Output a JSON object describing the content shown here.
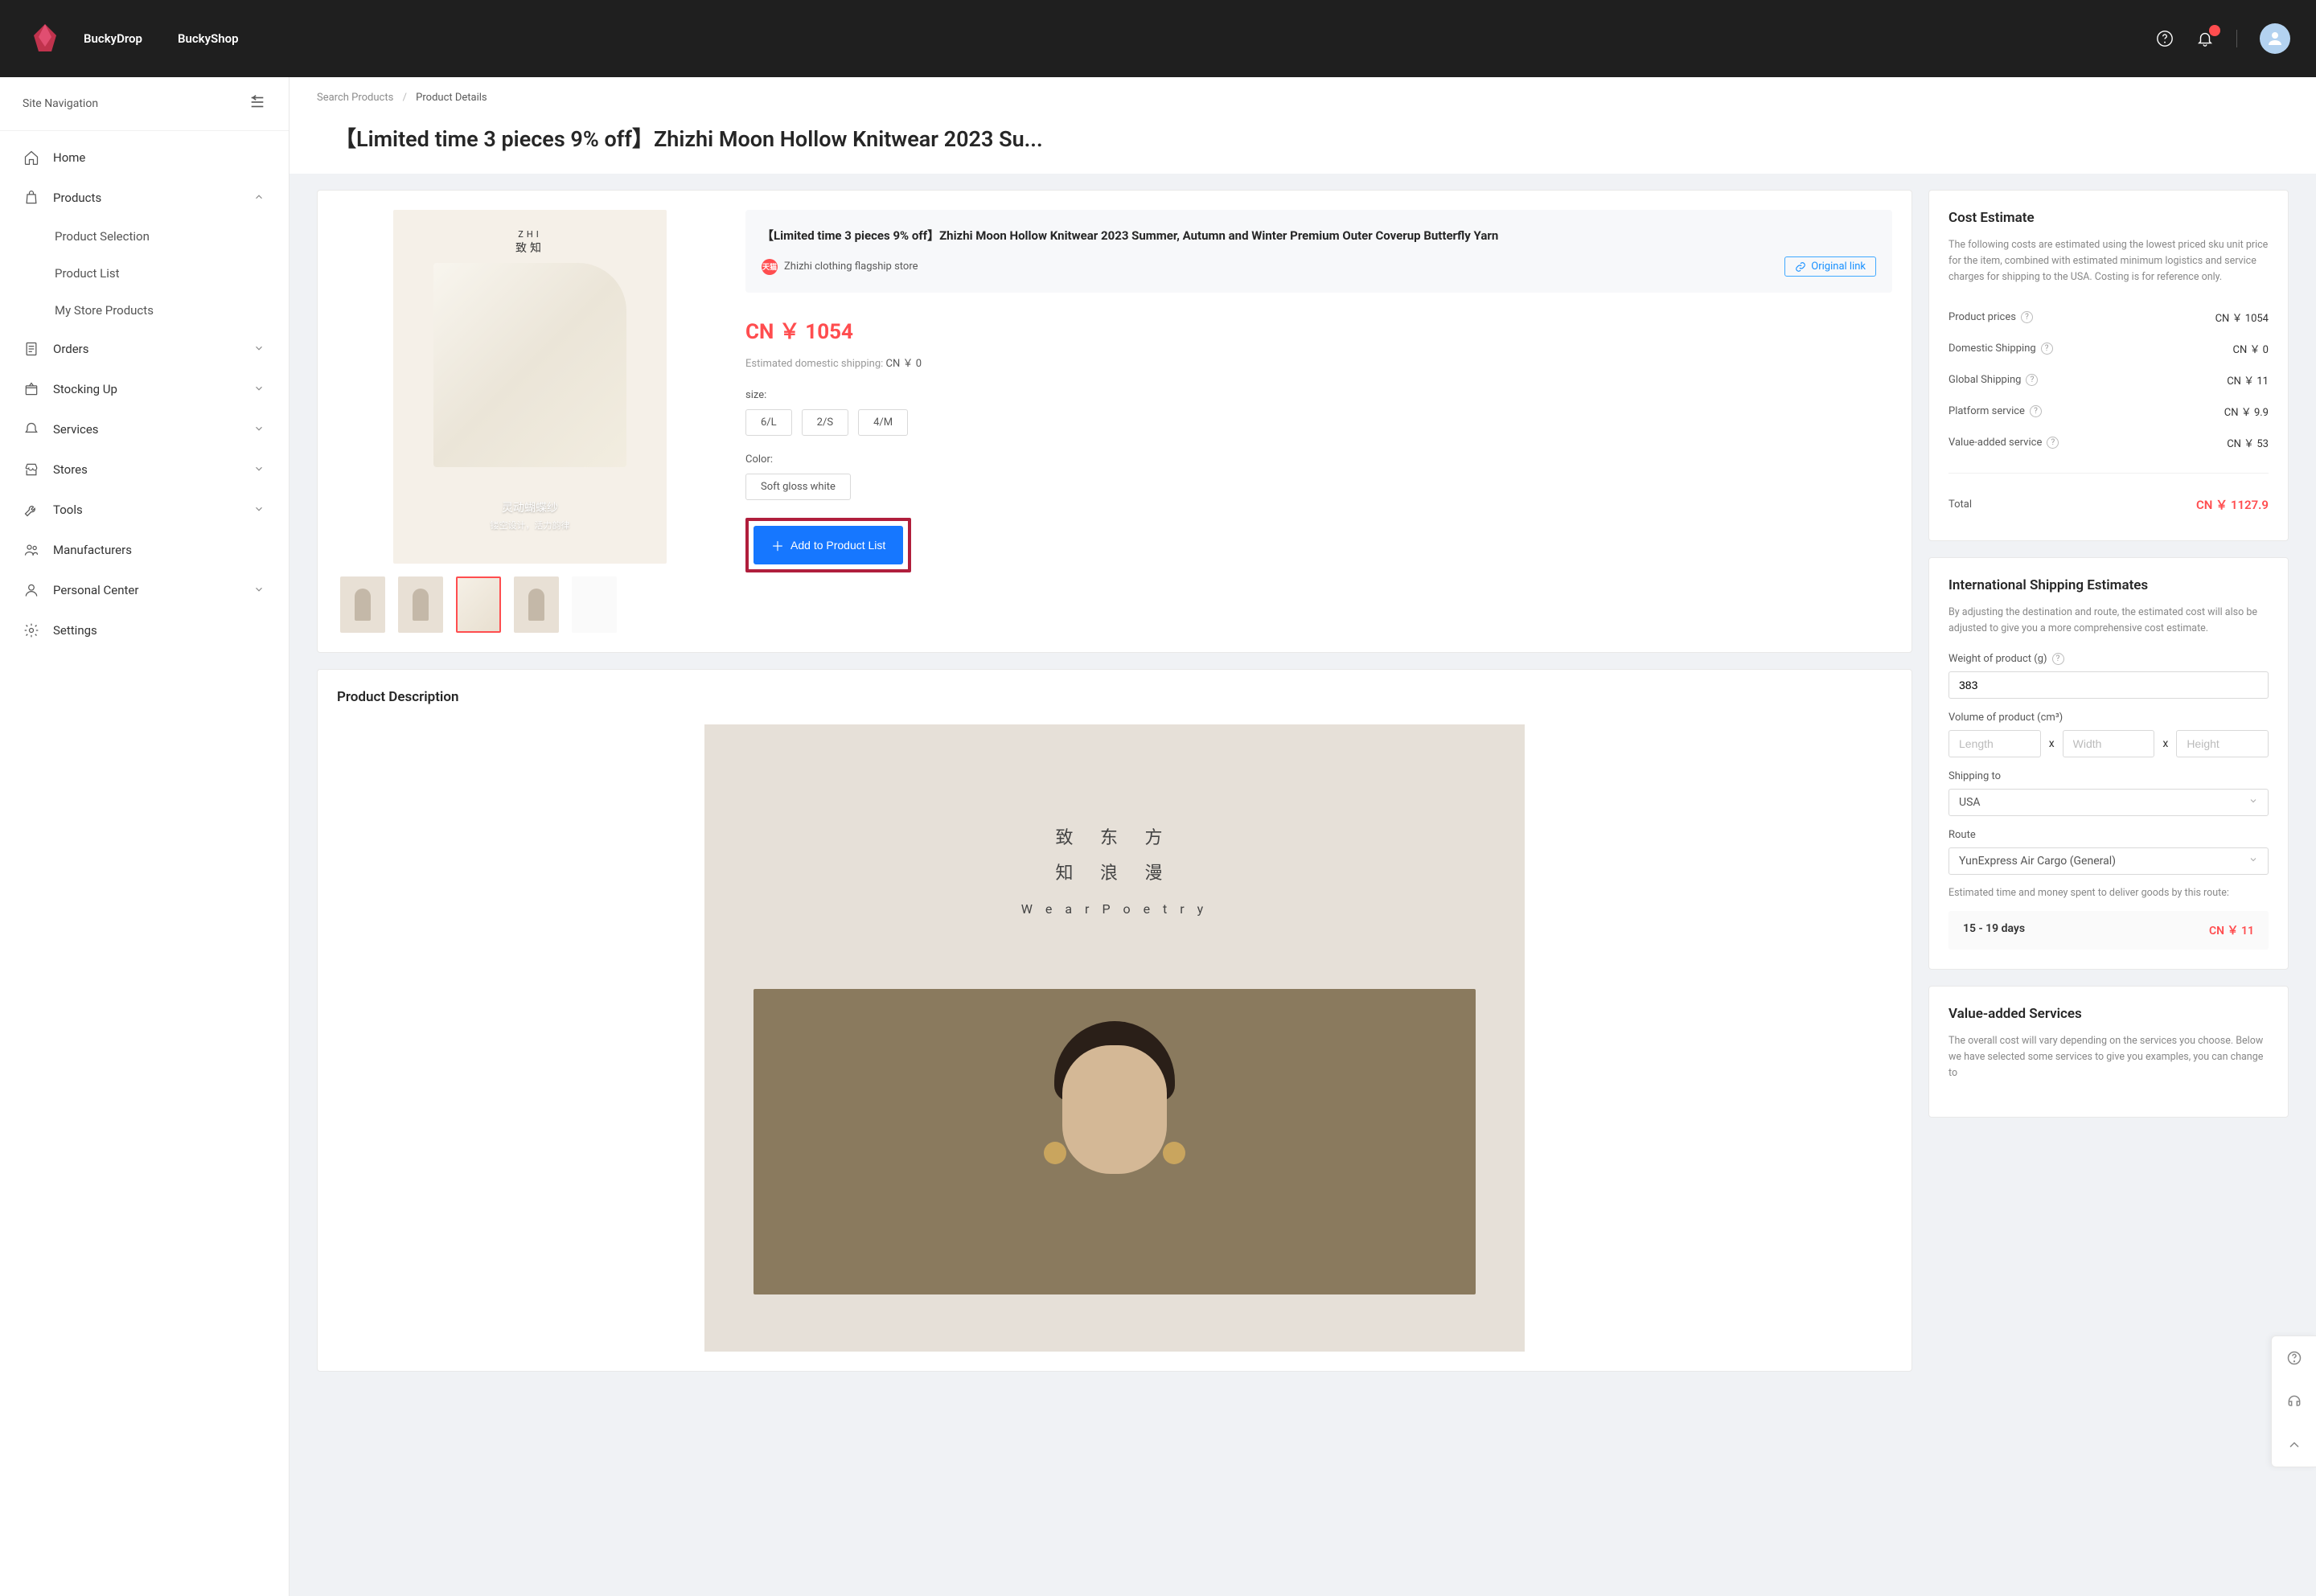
{
  "header": {
    "brand1": "BuckyDrop",
    "brand2": "BuckyShop",
    "notification_count": " "
  },
  "sidebar": {
    "title": "Site Navigation",
    "items": [
      {
        "label": "Home",
        "icon": "home"
      },
      {
        "label": "Products",
        "icon": "bag",
        "expanded": true,
        "children": [
          {
            "label": "Product Selection"
          },
          {
            "label": "Product List"
          },
          {
            "label": "My Store Products"
          }
        ]
      },
      {
        "label": "Orders",
        "icon": "doc",
        "children": true
      },
      {
        "label": "Stocking Up",
        "icon": "box",
        "children": true
      },
      {
        "label": "Services",
        "icon": "bell2",
        "children": true
      },
      {
        "label": "Stores",
        "icon": "store",
        "children": true
      },
      {
        "label": "Tools",
        "icon": "wrench",
        "children": true
      },
      {
        "label": "Manufacturers",
        "icon": "users"
      },
      {
        "label": "Personal Center",
        "icon": "person",
        "children": true
      },
      {
        "label": "Settings",
        "icon": "gear"
      }
    ]
  },
  "breadcrumb": {
    "a": "Search Products",
    "b": "Product Details"
  },
  "page_title": "【Limited time 3 pieces 9% off】Zhizhi Moon Hollow Knitwear 2023 Su...",
  "product": {
    "name": "【Limited time 3 pieces 9% off】Zhizhi Moon Hollow Knitwear 2023 Summer, Autumn and Winter Premium Outer Coverup Butterfly Yarn",
    "store": "Zhizhi clothing flagship store",
    "original_link": "Original link",
    "price": "CN ￥ 1054",
    "ship_label": "Estimated domestic shipping:",
    "ship_val": "CN ￥ 0",
    "brand_logo_top": "ZHI",
    "brand_logo_cn": "致知",
    "img_caption1": "灵动蝴蝶纱",
    "img_caption2": "镂空设计，活力韵律",
    "size_label": "size:",
    "sizes": [
      "6/L",
      "2/S",
      "4/M"
    ],
    "color_label": "Color:",
    "colors": [
      "Soft gloss white"
    ],
    "add_btn": "Add to Product List"
  },
  "desc": {
    "title": "Product Description",
    "cn1": "致 东 方",
    "cn2": "知 浪 漫",
    "en": "W e a r P o e t r y"
  },
  "cost": {
    "title": "Cost Estimate",
    "desc": "The following costs are estimated using the lowest priced sku unit price for the item, combined with estimated minimum logistics and service charges for shipping to the USA. Costing is for reference only.",
    "rows": [
      {
        "k": "Product prices",
        "v": "CN ￥ 1054",
        "q": true
      },
      {
        "k": "Domestic Shipping",
        "v": "CN ￥ 0",
        "q": true
      },
      {
        "k": "Global Shipping",
        "v": "CN ￥ 11",
        "q": true
      },
      {
        "k": "Platform service",
        "v": "CN ￥ 9.9",
        "q": true
      },
      {
        "k": "Value-added service",
        "v": "CN ￥ 53",
        "q": true
      }
    ],
    "total_k": "Total",
    "total_v": "CN ￥ 1127.9"
  },
  "shipping": {
    "title": "International Shipping Estimates",
    "desc": "By adjusting the destination and route, the estimated cost will also be adjusted to give you a more comprehensive cost estimate.",
    "weight_label": "Weight of product (g)",
    "weight_val": "383",
    "volume_label": "Volume of product (cm³)",
    "length_ph": "Length",
    "width_ph": "Width",
    "height_ph": "Height",
    "x": "x",
    "ship_to_label": "Shipping to",
    "ship_to_val": "USA",
    "route_label": "Route",
    "route_val": "YunExpress Air Cargo (General)",
    "route_note": "Estimated time and money spent to deliver goods by this route:",
    "days": "15 - 19 days",
    "cost": "CN ￥ 11"
  },
  "vas": {
    "title": "Value-added Services",
    "desc": "The overall cost will vary depending on the services you choose. Below we have selected some services to give you examples, you can change to"
  }
}
